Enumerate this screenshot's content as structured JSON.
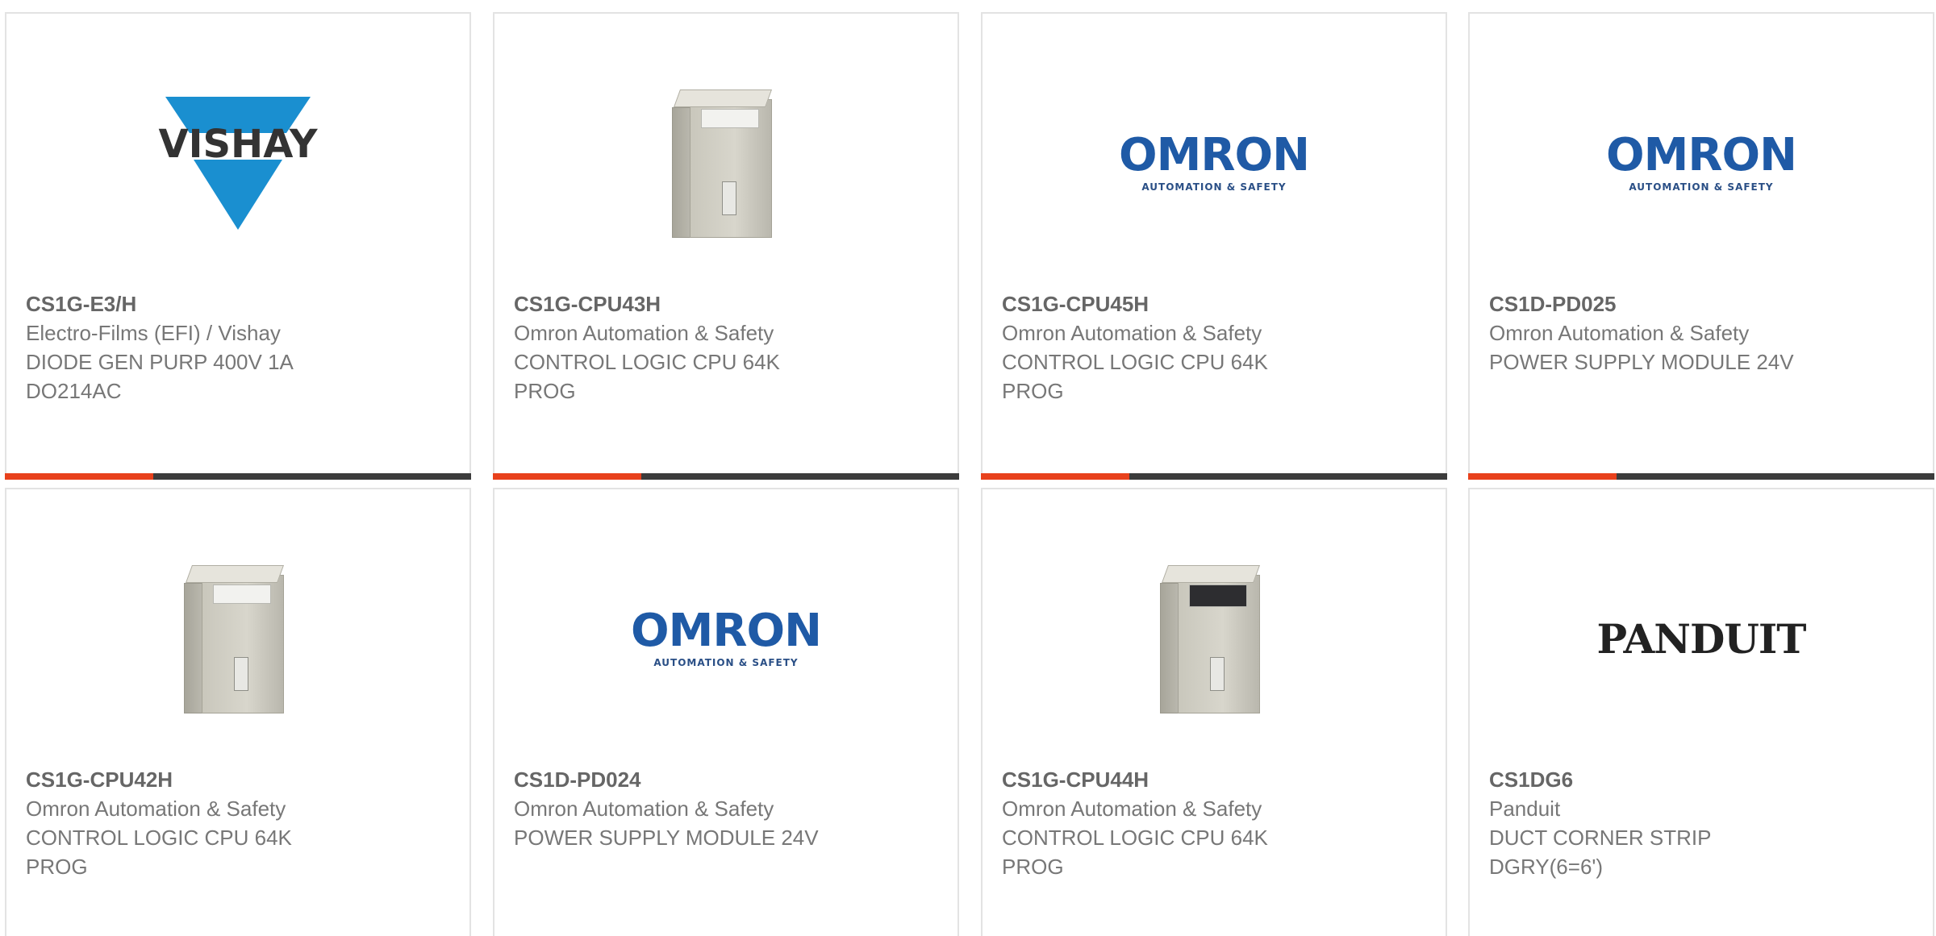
{
  "cards": [
    {
      "part": "CS1G-E3/H",
      "manufacturer": "Electro-Films (EFI) / Vishay",
      "description": "DIODE GEN PURP 400V 1A DO214AC",
      "image": "vishay-logo",
      "logo_text": "VISHAY"
    },
    {
      "part": "CS1G-CPU43H",
      "manufacturer": "Omron Automation & Safety",
      "description": "CONTROL LOGIC CPU 64K PROG",
      "image": "plc-module-photo"
    },
    {
      "part": "CS1G-CPU45H",
      "manufacturer": "Omron Automation & Safety",
      "description": "CONTROL LOGIC CPU 64K PROG",
      "image": "omron-logo",
      "logo_text": "OMRON",
      "logo_subtext": "AUTOMATION & SAFETY"
    },
    {
      "part": "CS1D-PD025",
      "manufacturer": "Omron Automation & Safety",
      "description": "POWER SUPPLY MODULE 24V",
      "image": "omron-logo",
      "logo_text": "OMRON",
      "logo_subtext": "AUTOMATION & SAFETY"
    },
    {
      "part": "CS1G-CPU42H",
      "manufacturer": "Omron Automation & Safety",
      "description": "CONTROL LOGIC CPU 64K PROG",
      "image": "plc-module-photo"
    },
    {
      "part": "CS1D-PD024",
      "manufacturer": "Omron Automation & Safety",
      "description": "POWER SUPPLY MODULE 24V",
      "image": "omron-logo",
      "logo_text": "OMRON",
      "logo_subtext": "AUTOMATION & SAFETY"
    },
    {
      "part": "CS1G-CPU44H",
      "manufacturer": "Omron Automation & Safety",
      "description": "CONTROL LOGIC CPU 64K PROG",
      "image": "plc-module-photo-dark"
    },
    {
      "part": "CS1DG6",
      "manufacturer": "Panduit",
      "description": "DUCT CORNER STRIP DGRY(6=6')",
      "image": "panduit-logo",
      "logo_text": "PANDUIT"
    }
  ],
  "colors": {
    "accent": "#e8411c",
    "bar": "#3c3c3c",
    "border": "#e3e3e3",
    "omron_blue": "#1f5aa6",
    "vishay_blue": "#1a8fd0"
  }
}
